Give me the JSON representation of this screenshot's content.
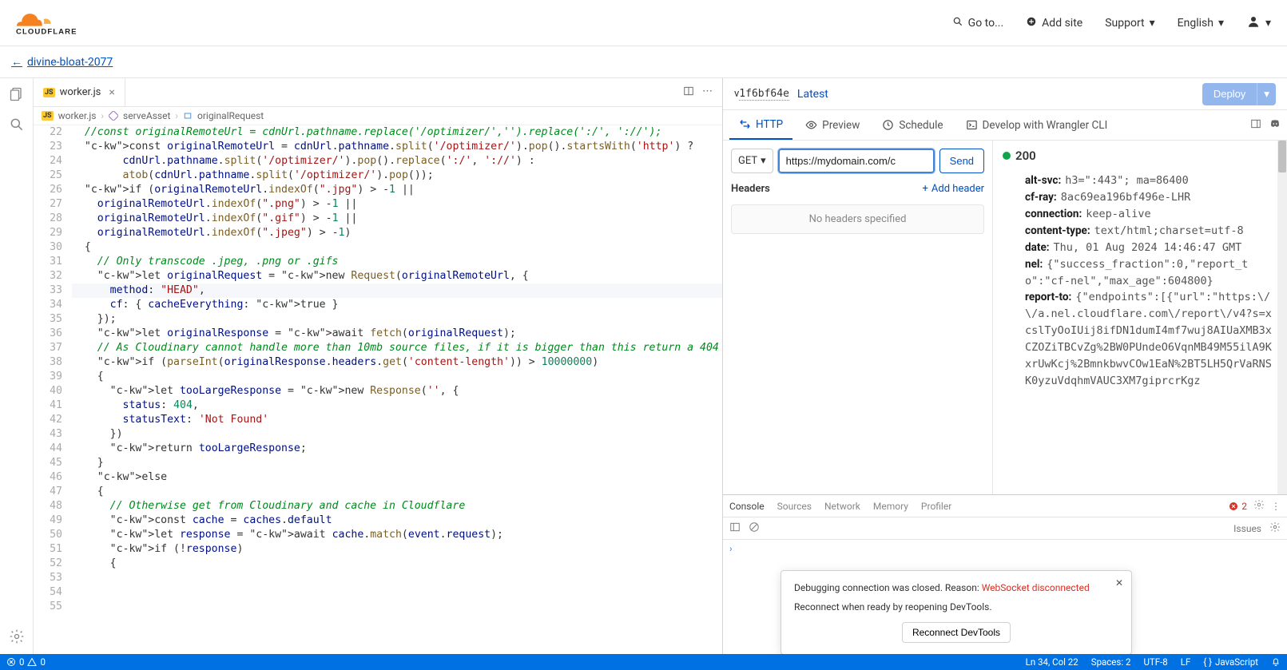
{
  "header": {
    "goto": "Go to...",
    "add_site": "Add site",
    "support": "Support",
    "language": "English"
  },
  "breadcrumb": {
    "back_label": "divine-bloat-2077"
  },
  "editor": {
    "tab_name": "worker.js",
    "crumbs": [
      "worker.js",
      "serveAsset",
      "originalRequest"
    ],
    "first_line": 22,
    "lines": [
      {
        "t": "//const originalRemoteUrl = cdnUrl.pathname.replace('/optimizer/','').replace(':/', '://');",
        "c": "comment",
        "ind": 1
      },
      {
        "t": "const originalRemoteUrl = cdnUrl.pathname.split('/optimizer/').pop().startsWith('http') ?",
        "ind": 1
      },
      {
        "t": "cdnUrl.pathname.split('/optimizer/').pop().replace(':/', '://') :",
        "ind": 4
      },
      {
        "t": "atob(cdnUrl.pathname.split('/optimizer/').pop());",
        "ind": 4
      },
      {
        "t": "",
        "ind": 0
      },
      {
        "t": "if (originalRemoteUrl.indexOf(\".jpg\") > -1 ||",
        "ind": 1
      },
      {
        "t": "originalRemoteUrl.indexOf(\".png\") > -1 ||",
        "ind": 2
      },
      {
        "t": "originalRemoteUrl.indexOf(\".gif\") > -1 ||",
        "ind": 2
      },
      {
        "t": "originalRemoteUrl.indexOf(\".jpeg\") > -1)",
        "ind": 2
      },
      {
        "t": "{",
        "ind": 1
      },
      {
        "t": "// Only transcode .jpeg, .png or .gifs",
        "c": "comment",
        "ind": 2
      },
      {
        "t": "let originalRequest = new Request(originalRemoteUrl, {",
        "ind": 2
      },
      {
        "t": "method: \"HEAD\",",
        "ind": 3,
        "hl": true
      },
      {
        "t": "cf: { cacheEverything: true }",
        "ind": 3
      },
      {
        "t": "});",
        "ind": 2
      },
      {
        "t": "",
        "ind": 0
      },
      {
        "t": "let originalResponse = await fetch(originalRequest);",
        "ind": 2
      },
      {
        "t": "",
        "ind": 0
      },
      {
        "t": "// As Cloudinary cannot handle more than 10mb source files, if it is bigger than this return a 404",
        "c": "comment",
        "ind": 2
      },
      {
        "t": "if (parseInt(originalResponse.headers.get('content-length')) > 10000000)",
        "ind": 2
      },
      {
        "t": "{",
        "ind": 2
      },
      {
        "t": "let tooLargeResponse = new Response('', {",
        "ind": 3
      },
      {
        "t": "status: 404,",
        "ind": 4
      },
      {
        "t": "statusText: 'Not Found'",
        "ind": 4
      },
      {
        "t": "})",
        "ind": 3
      },
      {
        "t": "return tooLargeResponse;",
        "ind": 3
      },
      {
        "t": "}",
        "ind": 2
      },
      {
        "t": "else",
        "ind": 2
      },
      {
        "t": "{",
        "ind": 2
      },
      {
        "t": "// Otherwise get from Cloudinary and cache in Cloudflare",
        "c": "comment",
        "ind": 3
      },
      {
        "t": "const cache = caches.default",
        "ind": 3
      },
      {
        "t": "let response = await cache.match(event.request);",
        "ind": 3
      },
      {
        "t": "if (!response)",
        "ind": 3
      },
      {
        "t": "{",
        "ind": 3
      }
    ]
  },
  "right": {
    "version_prefix": "v",
    "version_hash": "1f6bf64e",
    "latest": "Latest",
    "deploy": "Deploy",
    "tabs": {
      "http": "HTTP",
      "preview": "Preview",
      "schedule": "Schedule",
      "wrangler": "Develop with Wrangler CLI"
    },
    "request": {
      "method": "GET",
      "url": "https://mydomain.com/c",
      "send": "Send",
      "headers_label": "Headers",
      "add_header": "Add header",
      "no_headers": "No headers specified"
    },
    "response": {
      "status": "200",
      "headers": [
        {
          "k": "alt-svc:",
          "v": "h3=\":443\"; ma=86400"
        },
        {
          "k": "cf-ray:",
          "v": "8ac69ea196bf496e-LHR"
        },
        {
          "k": "connection:",
          "v": "keep-alive"
        },
        {
          "k": "content-type:",
          "v": "text/html;charset=utf-8"
        },
        {
          "k": "date:",
          "v": "Thu, 01 Aug 2024 14:46:47 GMT"
        },
        {
          "k": "nel:",
          "v": "{\"success_fraction\":0,\"report_to\":\"cf-nel\",\"max_age\":604800}"
        },
        {
          "k": "report-to:",
          "v": "{\"endpoints\":[{\"url\":\"https:\\/\\/a.nel.cloudflare.com\\/report\\/v4?s=xcslTyOoIUij8ifDN1dumI4mf7wuj8AIUaXMB3xCZOZiTBCvZg%2BW0PUndeO6VqnMB49M55ilA9KxrUwKcj%2BmnkbwvCOw1EaN%2BT5LH5QrVaRNSK0yzuVdqhmVAUC3XM7giprcrKgz"
        }
      ]
    }
  },
  "devtools": {
    "tabs": [
      "Console",
      "Sources",
      "Network",
      "Memory",
      "Profiler"
    ],
    "error_count": "2",
    "issues_label": "Issues",
    "popup_line1a": "Debugging connection was closed. Reason: ",
    "popup_line1b": "WebSocket disconnected",
    "popup_line2": "Reconnect when ready by reopening DevTools.",
    "reconnect": "Reconnect DevTools"
  },
  "statusbar": {
    "errors": "0",
    "warnings": "0",
    "cursor": "Ln 34, Col 22",
    "spaces": "Spaces: 2",
    "encoding": "UTF-8",
    "eol": "LF",
    "lang": "JavaScript"
  }
}
